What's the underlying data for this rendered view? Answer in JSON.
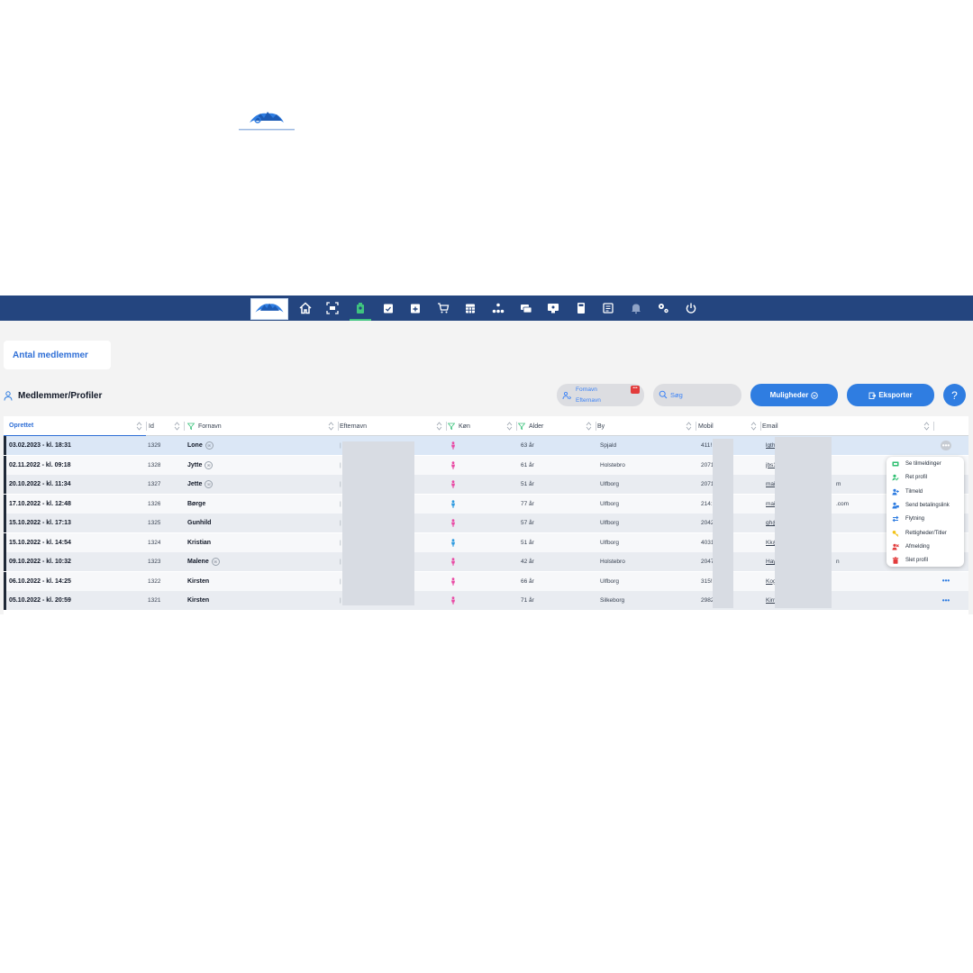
{
  "nav": {
    "icons": [
      "home-icon",
      "scan-icon",
      "members-icon",
      "calendar-check-icon",
      "calendar-plus-icon",
      "cart-icon",
      "calendar-grid-icon",
      "org-chart-icon",
      "cards-icon",
      "monitor-icon",
      "calculator-icon",
      "document-icon",
      "bell-icon",
      "settings-icon",
      "power-icon"
    ],
    "active": "members-icon",
    "colors": {
      "bar": "#24457f",
      "active": "#3fc47f"
    }
  },
  "count_card": {
    "label": "Antal medlemmer"
  },
  "page": {
    "title": "Medlemmer/Profiler"
  },
  "toolbar": {
    "name_toggle": {
      "first": "Fornavn",
      "last": "Efternavn",
      "flag": "•••"
    },
    "search_placeholder": "Søg",
    "options_label": "Muligheder",
    "export_label": "Eksporter",
    "help_label": "?"
  },
  "table": {
    "columns": {
      "created": "Oprettet",
      "id": "Id",
      "firstname": "Fornavn",
      "lastname": "Efternavn",
      "gender": "Køn",
      "age": "Alder",
      "city": "By",
      "mobile": "Mobil",
      "email": "Email"
    },
    "rows": [
      {
        "created": "03.02.2023 - kl. 18:31",
        "id": "1329",
        "firstname": "Lone",
        "badge": "✉",
        "lastname": "",
        "gender": "female",
        "age": "63 år",
        "city": "Spjald",
        "mobile": "411!",
        "email": "lgth",
        "email_suffix": ""
      },
      {
        "created": "02.11.2022 - kl. 09:18",
        "id": "1328",
        "firstname": "Jytte",
        "badge": "✉",
        "lastname": "",
        "gender": "female",
        "age": "61 år",
        "city": "Holstebro",
        "mobile": "2071",
        "email": "jbs1",
        "email_suffix": ""
      },
      {
        "created": "20.10.2022 - kl. 11:34",
        "id": "1327",
        "firstname": "Jette",
        "badge": "☏",
        "lastname": "",
        "gender": "female",
        "age": "51 år",
        "city": "Ulfborg",
        "mobile": "2071",
        "email": "mai",
        "email_suffix": "m"
      },
      {
        "created": "17.10.2022 - kl. 12:48",
        "id": "1326",
        "firstname": "Børge",
        "badge": "",
        "lastname": "",
        "gender": "male",
        "age": "77 år",
        "city": "Ulfborg",
        "mobile": "214:",
        "email": "mai",
        "email_suffix": ".com"
      },
      {
        "created": "15.10.2022 - kl. 17:13",
        "id": "1325",
        "firstname": "Gunhild",
        "badge": "",
        "lastname": "",
        "gender": "female",
        "age": "57 år",
        "city": "Ulfborg",
        "mobile": "2042",
        "email": "gh@",
        "email_suffix": ""
      },
      {
        "created": "15.10.2022 - kl. 14:54",
        "id": "1324",
        "firstname": "Kristian",
        "badge": "",
        "lastname": "",
        "gender": "male",
        "age": "51 år",
        "city": "Ulfborg",
        "mobile": "4031",
        "email": "Kk@",
        "email_suffix": ""
      },
      {
        "created": "09.10.2022 - kl. 10:32",
        "id": "1323",
        "firstname": "Malene",
        "badge": "✉",
        "lastname": "",
        "gender": "female",
        "age": "42 år",
        "city": "Holstebro",
        "mobile": "2047",
        "email": "Hay",
        "email_suffix": "n"
      },
      {
        "created": "06.10.2022 - kl. 14:25",
        "id": "1322",
        "firstname": "Kirsten",
        "badge": "",
        "lastname": "",
        "gender": "female",
        "age": "66 år",
        "city": "Ulfborg",
        "mobile": "315!",
        "email": "Kog",
        "email_suffix": ""
      },
      {
        "created": "05.10.2022 - kl. 20:59",
        "id": "1321",
        "firstname": "Kirsten",
        "badge": "",
        "lastname": "",
        "gender": "female",
        "age": "71 år",
        "city": "Silkeborg",
        "mobile": "2982",
        "email": "Kirn",
        "email_suffix": ""
      }
    ],
    "row_menu_glyph": "•••",
    "gender_colors": {
      "female": "#e94ba5",
      "male": "#2f9be0"
    }
  },
  "context_menu": {
    "items": [
      {
        "label": "Se tilmeldinger",
        "icon": "ticket-icon",
        "color": "#2fbf71"
      },
      {
        "label": "Ret profil",
        "icon": "edit-user-icon",
        "color": "#2fbf71"
      },
      {
        "label": "Tilmeld",
        "icon": "add-user-icon",
        "color": "#2f7de1"
      },
      {
        "label": "Send betalingslink",
        "icon": "payment-link-icon",
        "color": "#2f7de1"
      },
      {
        "label": "Flytning",
        "icon": "transfer-icon",
        "color": "#2f7de1"
      },
      {
        "label": "Rettigheder/Titler",
        "icon": "key-icon",
        "color": "#f2c318"
      },
      {
        "label": "Afmelding",
        "icon": "remove-user-icon",
        "color": "#e23b3b"
      },
      {
        "label": "Slet profil",
        "icon": "trash-icon",
        "color": "#e23b3b"
      }
    ]
  }
}
